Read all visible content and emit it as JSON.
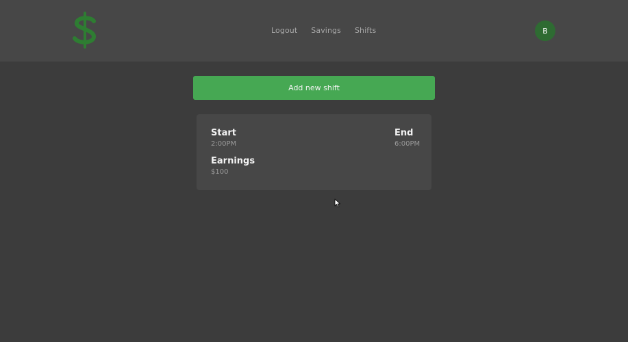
{
  "header": {
    "logo_icon": "dollar-sign-icon",
    "logo_color": "#2e7d32",
    "nav": {
      "logout": "Logout",
      "savings": "Savings",
      "shifts": "Shifts"
    },
    "avatar_initial": "B",
    "avatar_color": "#2e6b32"
  },
  "actions": {
    "add_shift_label": "Add new shift",
    "add_shift_color": "#46a853"
  },
  "shift": {
    "start_label": "Start",
    "start_value": "2:00PM",
    "end_label": "End",
    "end_value": "6:00PM",
    "earnings_label": "Earnings",
    "earnings_value": "$100"
  }
}
